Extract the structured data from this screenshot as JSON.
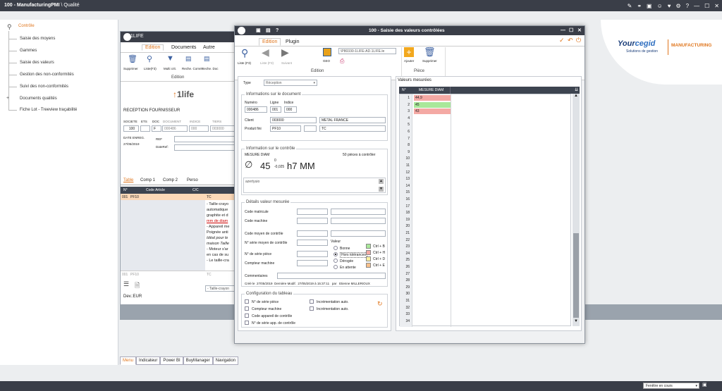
{
  "app": {
    "title": "100 - ManufacturingPMI",
    "breadcrumb": " \\ Qualité"
  },
  "sidebar": {
    "items": [
      "Contrôle",
      "Saisie des moyens",
      "Gammes",
      "Saisie des valeurs",
      "Gestion des non-conformités",
      "Suivi des non-conformités",
      "Documents qualités",
      "Fiche Lot - Treeview traçabilité"
    ],
    "expand": "+"
  },
  "bottom_tabs": [
    "Menu",
    "Indicateur",
    "Power BI",
    "BuyManager",
    "Navigation"
  ],
  "status": {
    "window_select": "Fenêtre en cours"
  },
  "logo": {
    "your": "Your",
    "cegid": "cegid",
    "solutions": "Solutions de gestion",
    "manufacturing": "MANUFACTURING"
  },
  "bgwin": {
    "title_partial": "1LIFE",
    "tabs": [
      "Edition",
      "Documents",
      "Autre"
    ],
    "toolbar": [
      "Supprimer",
      "Liste(F3)",
      "Multi crit.",
      "Reche. Comm.",
      "Reche. Doc"
    ],
    "group": "Edition",
    "brand": "1life",
    "reception": "RECEPTION FOURNISSEUR",
    "doc_labels": [
      "SOCIETE",
      "ETS",
      "DOC",
      "DOCUMENT",
      "INDICE",
      "TIERS"
    ],
    "doc_values": [
      "100",
      "",
      "F",
      "000486",
      "000",
      "003000"
    ],
    "date_label": "DATE ENREG.",
    "date": "27/05/2019",
    "ref_label": "REF",
    "dateref_label": "DateRef:",
    "subtabs": [
      "Table",
      "Comp 1",
      "Comp 2",
      "Perso"
    ],
    "grid_head": [
      "N°",
      "Code Article",
      "C/C"
    ],
    "row1": [
      "001",
      "PF10",
      "TC"
    ],
    "notes": [
      "- Taille-crayo",
      "automatique",
      "graphite et d",
      "mm de diam",
      "- Appareil me",
      "Poignée anti",
      "Idéal pour le",
      "maison Taille",
      "- Moteur s'ar",
      "en cas de su",
      "- Le taille-cra"
    ],
    "row2": [
      "001",
      "PF10",
      "TC"
    ],
    "row3": "- Taille-crayon",
    "currency": "Dev.:EUR"
  },
  "fg": {
    "title": "100 - Saisie des valeurs contrôlées",
    "tabs": [
      "Edition",
      "Plugin"
    ],
    "toolbar": [
      "Liste (F3)",
      "Liste (F3)",
      "Suivant"
    ],
    "geo": "GEO",
    "path": "\\P80330-1LIFE-AD.1LIFE.le",
    "group_edition": "Edition",
    "group_piece": "Pièce",
    "btn_add": "Ajouter",
    "btn_delete": "Supprimer",
    "type_label": "Type",
    "type_value": "Réception",
    "doc_info": {
      "title": "Informations sur le document",
      "num_label": "Numéro",
      "line_label": "Ligne",
      "indice_label": "Indice",
      "num": "000486",
      "line": "001",
      "indice": "000",
      "client_label": "Client",
      "client_code": "003000",
      "client_name": "METAL FRANCE",
      "product_label": "Produit fini",
      "product_code": "PF10",
      "product_extra": "",
      "product_name": "TC"
    },
    "control": {
      "title": "Information sur le contrôle",
      "measure": "MESURE DIAM",
      "pieces": "50 pièces à contrôler",
      "nominal": "45",
      "tol_up": "0",
      "tol_down": "-0,025",
      "fit": "h7 MM",
      "comment": "azertyuio"
    },
    "details": {
      "title": "Détails valeur mesurée",
      "labels": [
        "Code matricule",
        "Code machine",
        "Code moyen de contrôle",
        "N° série moyen de contrôle",
        "N° de série pièce",
        "Compteur machine"
      ],
      "valeur_label": "Valeur",
      "options": [
        "Bonne",
        "Hors tolérances",
        "Dérogée",
        "En attente"
      ],
      "shortcuts": [
        "Ctrl + B",
        "Ctrl + H",
        "Ctrl + D",
        "Ctrl + E"
      ],
      "colors": [
        "#a9e89a",
        "#f4a9a4",
        "#faf0a0",
        "#f7c08a"
      ],
      "comment_label": "Commentaires",
      "created": "Créé le",
      "created_date": "27/05/2019",
      "modified": "Dernière Modif.",
      "modified_date": "27/05/2019 à 15:37:11",
      "by": "par",
      "user": "Etienne MILLERIOUX"
    },
    "config": {
      "title": "Configuration du tableau",
      "left": [
        "N° de série pièce",
        "Compteur machine",
        "Code appareil de contrôle",
        "N° de série app. de contrôle"
      ],
      "right": [
        "Incrémentation auto.",
        "Incrémentation auto."
      ]
    },
    "values": {
      "title": "Valeurs mesurées",
      "head_num": "N°",
      "head_col": "MESURE DIAM",
      "rows": [
        {
          "n": "1",
          "v": "44,9",
          "color": "#f4a9a4"
        },
        {
          "n": "2",
          "v": "45",
          "color": "#a9e89a"
        },
        {
          "n": "3",
          "v": "43",
          "color": "#f4a9a4"
        }
      ],
      "empty_rows": [
        "4",
        "5",
        "6",
        "7",
        "8",
        "9",
        "10",
        "11",
        "12",
        "13",
        "14",
        "15",
        "16",
        "17",
        "18",
        "19",
        "20",
        "21",
        "22",
        "23",
        "24",
        "25",
        "26",
        "27",
        "28",
        "29",
        "30",
        "31",
        "32",
        "33",
        "34"
      ]
    }
  }
}
